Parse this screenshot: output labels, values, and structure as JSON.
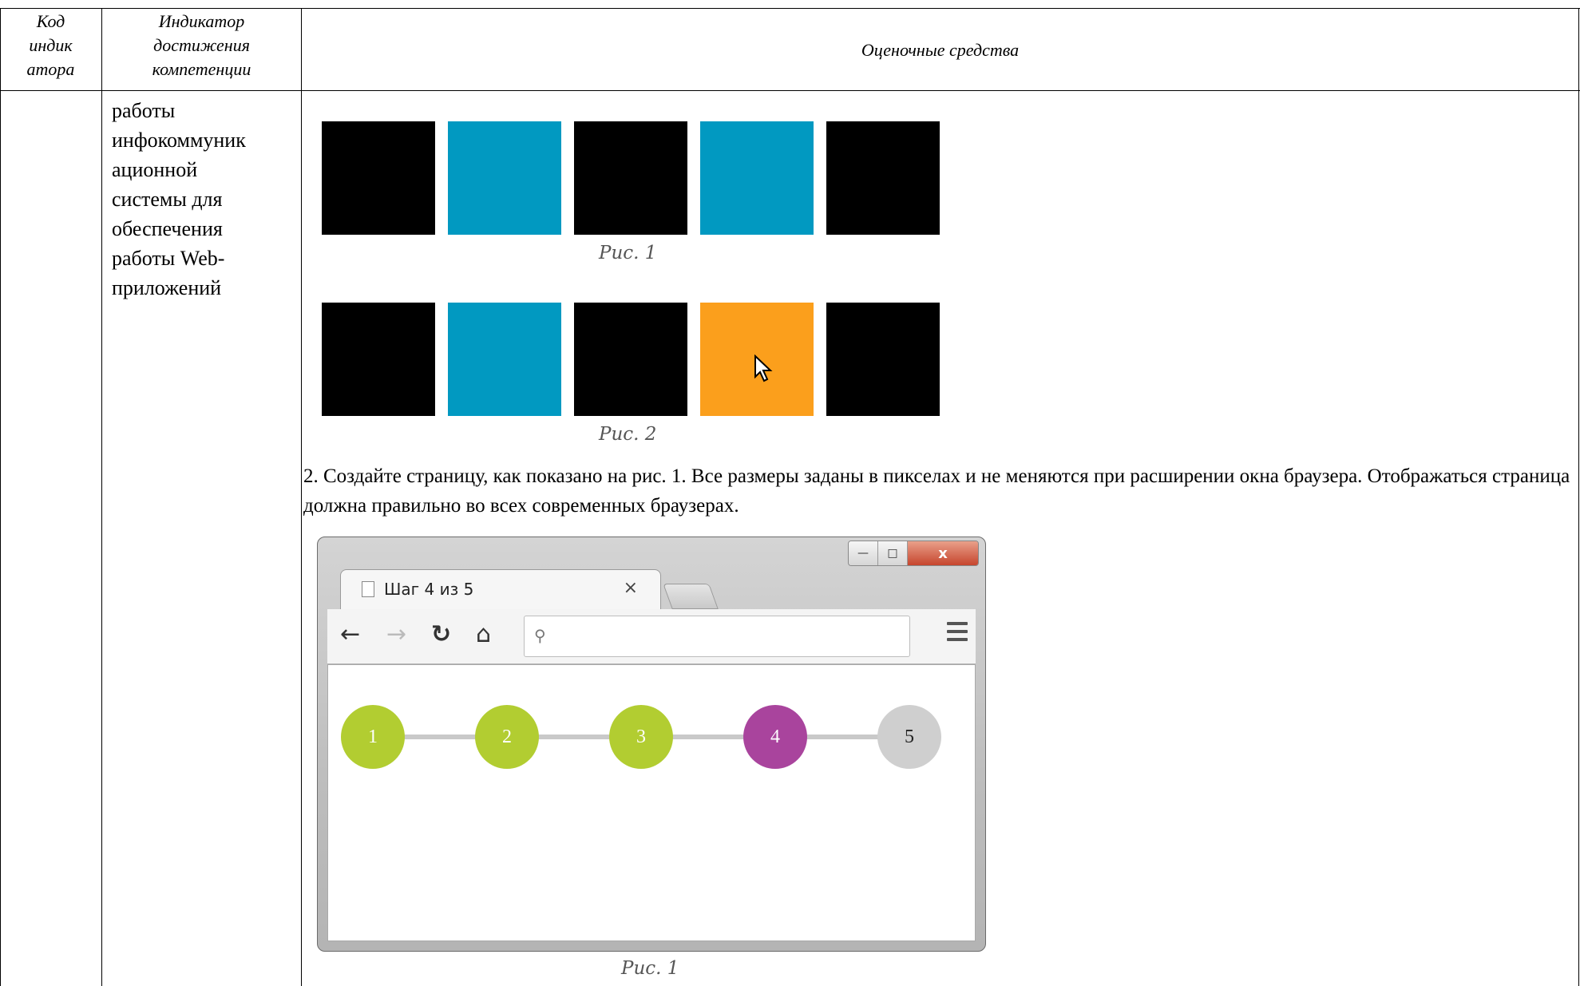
{
  "header": {
    "code_lines": [
      "Код",
      "индик",
      "атора"
    ],
    "indicator_lines": [
      "Индикатор",
      "достижения",
      "компетенции"
    ],
    "assessment": "Оценочные средства"
  },
  "indicator_text_lines": [
    "работы",
    "инфокоммуник",
    "ационной",
    "системы для",
    "обеспечения",
    "работы Web-",
    "приложений"
  ],
  "figure1": {
    "caption": "Рис. 1",
    "square_colors": [
      "#000000",
      "#0199c1",
      "#000000",
      "#0199c1",
      "#000000"
    ]
  },
  "figure2": {
    "caption": "Рис. 2",
    "square_colors": [
      "#000000",
      "#0199c1",
      "#000000",
      "#fb9f1c",
      "#000000"
    ]
  },
  "task_text": "2. Создайте страницу, как показано на рис. 1. Все размеры заданы в пикселах и не меняются при расширении окна браузера. Отображаться страница должна правильно во всех современных браузерах.",
  "browser": {
    "tab_title": "Шаг 4 из 5",
    "tab_close": "×",
    "window_controls": {
      "minimize": "—",
      "maximize": "□",
      "close": "x"
    },
    "toolbar_icons": [
      "back-arrow-icon",
      "forward-arrow-icon",
      "reload-icon",
      "home-icon",
      "search-icon",
      "menu-icon"
    ],
    "steps": [
      {
        "label": "1",
        "color": "#b2cd31"
      },
      {
        "label": "2",
        "color": "#b2cd31"
      },
      {
        "label": "3",
        "color": "#b2cd31"
      },
      {
        "label": "4",
        "color": "#a9449d"
      },
      {
        "label": "5",
        "color": "#cfcfcf"
      }
    ]
  },
  "figure3": {
    "caption": "Рис. 1"
  }
}
